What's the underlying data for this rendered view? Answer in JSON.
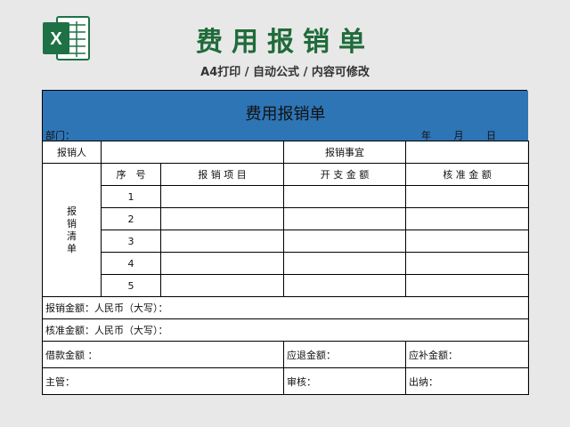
{
  "header": {
    "title": "费用报销单",
    "subtitle": "A4打印 / 自动公式 / 内容可修改",
    "logo_letter": "X"
  },
  "form": {
    "title": "费用报销单",
    "dept_label": "部门：",
    "date_year": "年",
    "date_month": "月",
    "date_day": "日",
    "claimant_label": "报销人",
    "matter_label": "报销事宜",
    "list_label": [
      "报",
      "销",
      "清",
      "单"
    ],
    "columns": [
      "序　号",
      "报 销 项 目",
      "开 支 金 额",
      "核 准 金 额"
    ],
    "rows": [
      "1",
      "2",
      "3",
      "4",
      "5"
    ],
    "claim_amount_label": "报销金额：人民币（大写）：",
    "approved_amount_label": "核准金额：人民币（大写）：",
    "loan_label": "借款金额 ：",
    "refund_label": "应退金额：",
    "supplement_label": "应补金额：",
    "supervisor_label": "主管：",
    "audit_label": "审核：",
    "cashier_label": "出纳："
  },
  "colors": {
    "excel_green": "#1e7145",
    "title_green": "#1f6b3a",
    "band_blue": "#2e75b6"
  }
}
